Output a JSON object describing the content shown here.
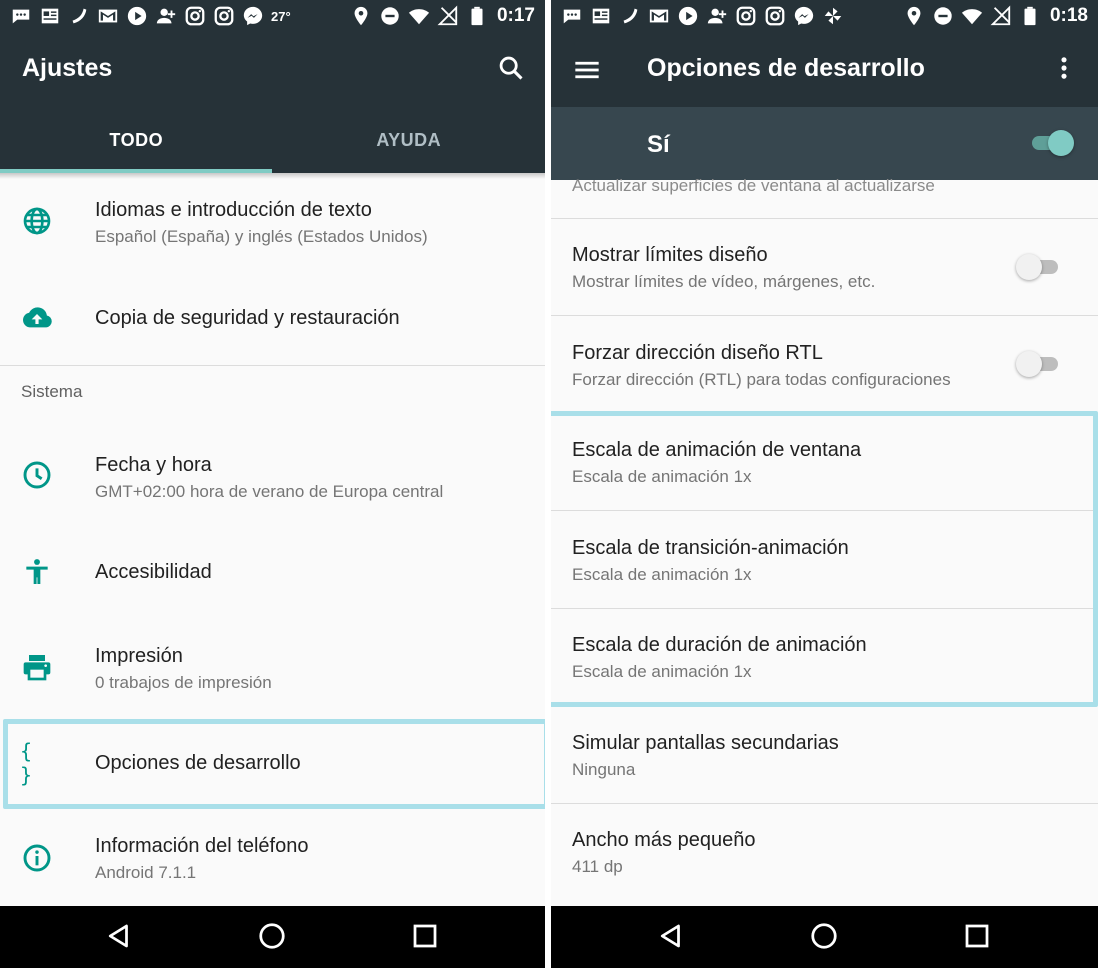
{
  "left": {
    "status": {
      "temperature": "27°",
      "time": "0:17"
    },
    "appbar": {
      "title": "Ajustes"
    },
    "tabs": [
      {
        "label": "TODO"
      },
      {
        "label": "AYUDA"
      }
    ],
    "items_top": [
      {
        "title": "Idiomas e introducción de texto",
        "subtitle": "Español (España) y inglés (Estados Unidos)",
        "icon": "globe-icon"
      },
      {
        "title": "Copia de seguridad y restauración",
        "subtitle": "",
        "icon": "cloud-upload-icon"
      }
    ],
    "section": {
      "label": "Sistema"
    },
    "items_system": [
      {
        "title": "Fecha y hora",
        "subtitle": "GMT+02:00 hora de verano de Europa central",
        "icon": "clock-icon"
      },
      {
        "title": "Accesibilidad",
        "subtitle": "",
        "icon": "accessibility-icon"
      },
      {
        "title": "Impresión",
        "subtitle": "0 trabajos de impresión",
        "icon": "printer-icon"
      },
      {
        "title": "Opciones de desarrollo",
        "subtitle": "",
        "icon": "braces-icon"
      },
      {
        "title": "Información del teléfono",
        "subtitle": "Android 7.1.1",
        "icon": "info-icon"
      }
    ]
  },
  "right": {
    "status": {
      "time": "0:18"
    },
    "appbar": {
      "title": "Opciones de desarrollo"
    },
    "master": {
      "label": "Sí",
      "enabled": true
    },
    "partial_row": {
      "text": "Actualizar superficies de ventana al actualizarse"
    },
    "items": [
      {
        "title": "Mostrar límites diseño",
        "subtitle": "Mostrar límites de vídeo, márgenes, etc.",
        "toggle": false
      },
      {
        "title": "Forzar dirección diseño RTL",
        "subtitle": "Forzar dirección (RTL) para todas configuraciones",
        "toggle": false
      },
      {
        "title": "Escala de animación de ventana",
        "subtitle": "Escala de animación 1x"
      },
      {
        "title": "Escala de transición-animación",
        "subtitle": "Escala de animación 1x"
      },
      {
        "title": "Escala de duración de animación",
        "subtitle": "Escala de animación 1x"
      },
      {
        "title": "Simular pantallas secundarias",
        "subtitle": "Ninguna"
      },
      {
        "title": "Ancho más pequeño",
        "subtitle": "411 dp"
      }
    ]
  },
  "colors": {
    "appbar": "#263238",
    "accent": "#009688",
    "tab_indicator": "#80cbc4",
    "highlight": "#a9dfe9"
  }
}
